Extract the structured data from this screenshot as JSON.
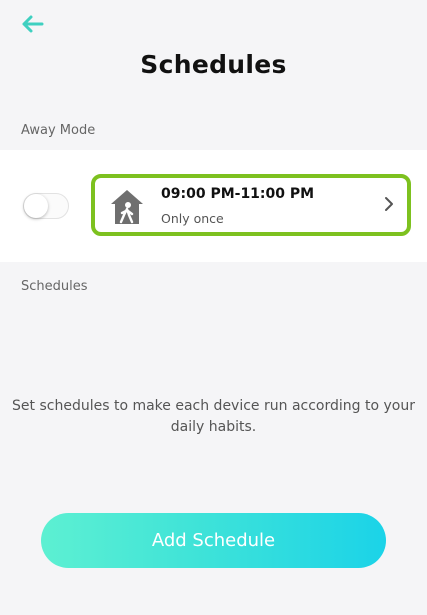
{
  "header": {
    "title": "Schedules",
    "back_icon": "arrow-left-icon"
  },
  "away_mode": {
    "section_label": "Away Mode",
    "toggle_on": false,
    "schedule": {
      "time_range": "09:00 PM-11:00 PM",
      "repeat": "Only once",
      "icon": "house-person-icon",
      "highlight_color": "#7dc11f"
    }
  },
  "schedules": {
    "section_label": "Schedules",
    "empty_message": "Set schedules to make each device run according to your daily habits."
  },
  "actions": {
    "add_schedule_label": "Add Schedule"
  },
  "colors": {
    "accent": "#3fd6c8",
    "highlight": "#7dc11f"
  }
}
